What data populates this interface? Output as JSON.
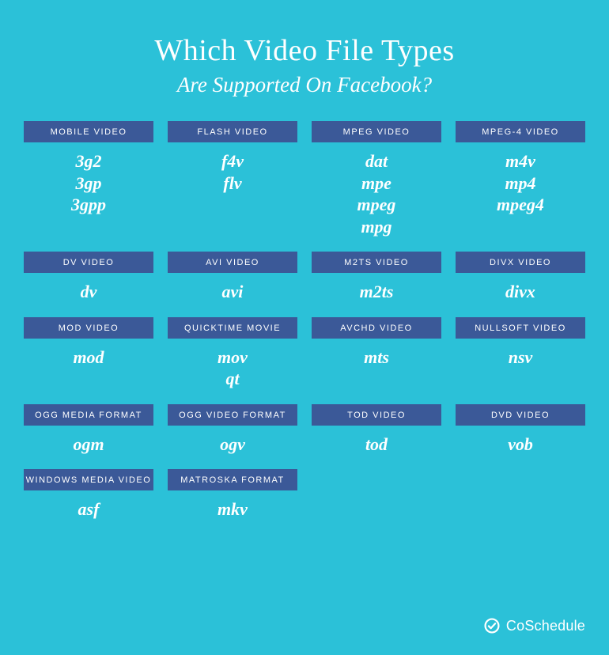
{
  "header": {
    "title": "Which Video File Types",
    "subtitle": "Are Supported On Facebook?"
  },
  "colors": {
    "background": "#2bc1d8",
    "label_bg": "#3b5998",
    "text": "#ffffff"
  },
  "categories": [
    {
      "label": "MOBILE VIDEO",
      "exts": [
        "3g2",
        "3gp",
        "3gpp"
      ]
    },
    {
      "label": "FLASH VIDEO",
      "exts": [
        "f4v",
        "flv"
      ]
    },
    {
      "label": "MPEG VIDEO",
      "exts": [
        "dat",
        "mpe",
        "mpeg",
        "mpg"
      ]
    },
    {
      "label": "MPEG-4 VIDEO",
      "exts": [
        "m4v",
        "mp4",
        "mpeg4"
      ]
    },
    {
      "label": "DV VIDEO",
      "exts": [
        "dv"
      ]
    },
    {
      "label": "AVI VIDEO",
      "exts": [
        "avi"
      ]
    },
    {
      "label": "M2TS VIDEO",
      "exts": [
        "m2ts"
      ]
    },
    {
      "label": "DIVX VIDEO",
      "exts": [
        "divx"
      ]
    },
    {
      "label": "MOD VIDEO",
      "exts": [
        "mod"
      ]
    },
    {
      "label": "QUICKTIME MOVIE",
      "exts": [
        "mov",
        "qt"
      ]
    },
    {
      "label": "AVCHD VIDEO",
      "exts": [
        "mts"
      ]
    },
    {
      "label": "NULLSOFT VIDEO",
      "exts": [
        "nsv"
      ]
    },
    {
      "label": "OGG MEDIA FORMAT",
      "exts": [
        "ogm"
      ]
    },
    {
      "label": "OGG VIDEO FORMAT",
      "exts": [
        "ogv"
      ]
    },
    {
      "label": "TOD VIDEO",
      "exts": [
        "tod"
      ]
    },
    {
      "label": "DVD VIDEO",
      "exts": [
        "vob"
      ]
    },
    {
      "label": "WINDOWS MEDIA VIDEO",
      "exts": [
        "asf"
      ]
    },
    {
      "label": "MATROSKA FORMAT",
      "exts": [
        "mkv"
      ]
    }
  ],
  "brand": {
    "name": "CoSchedule",
    "icon": "coschedule-icon"
  }
}
